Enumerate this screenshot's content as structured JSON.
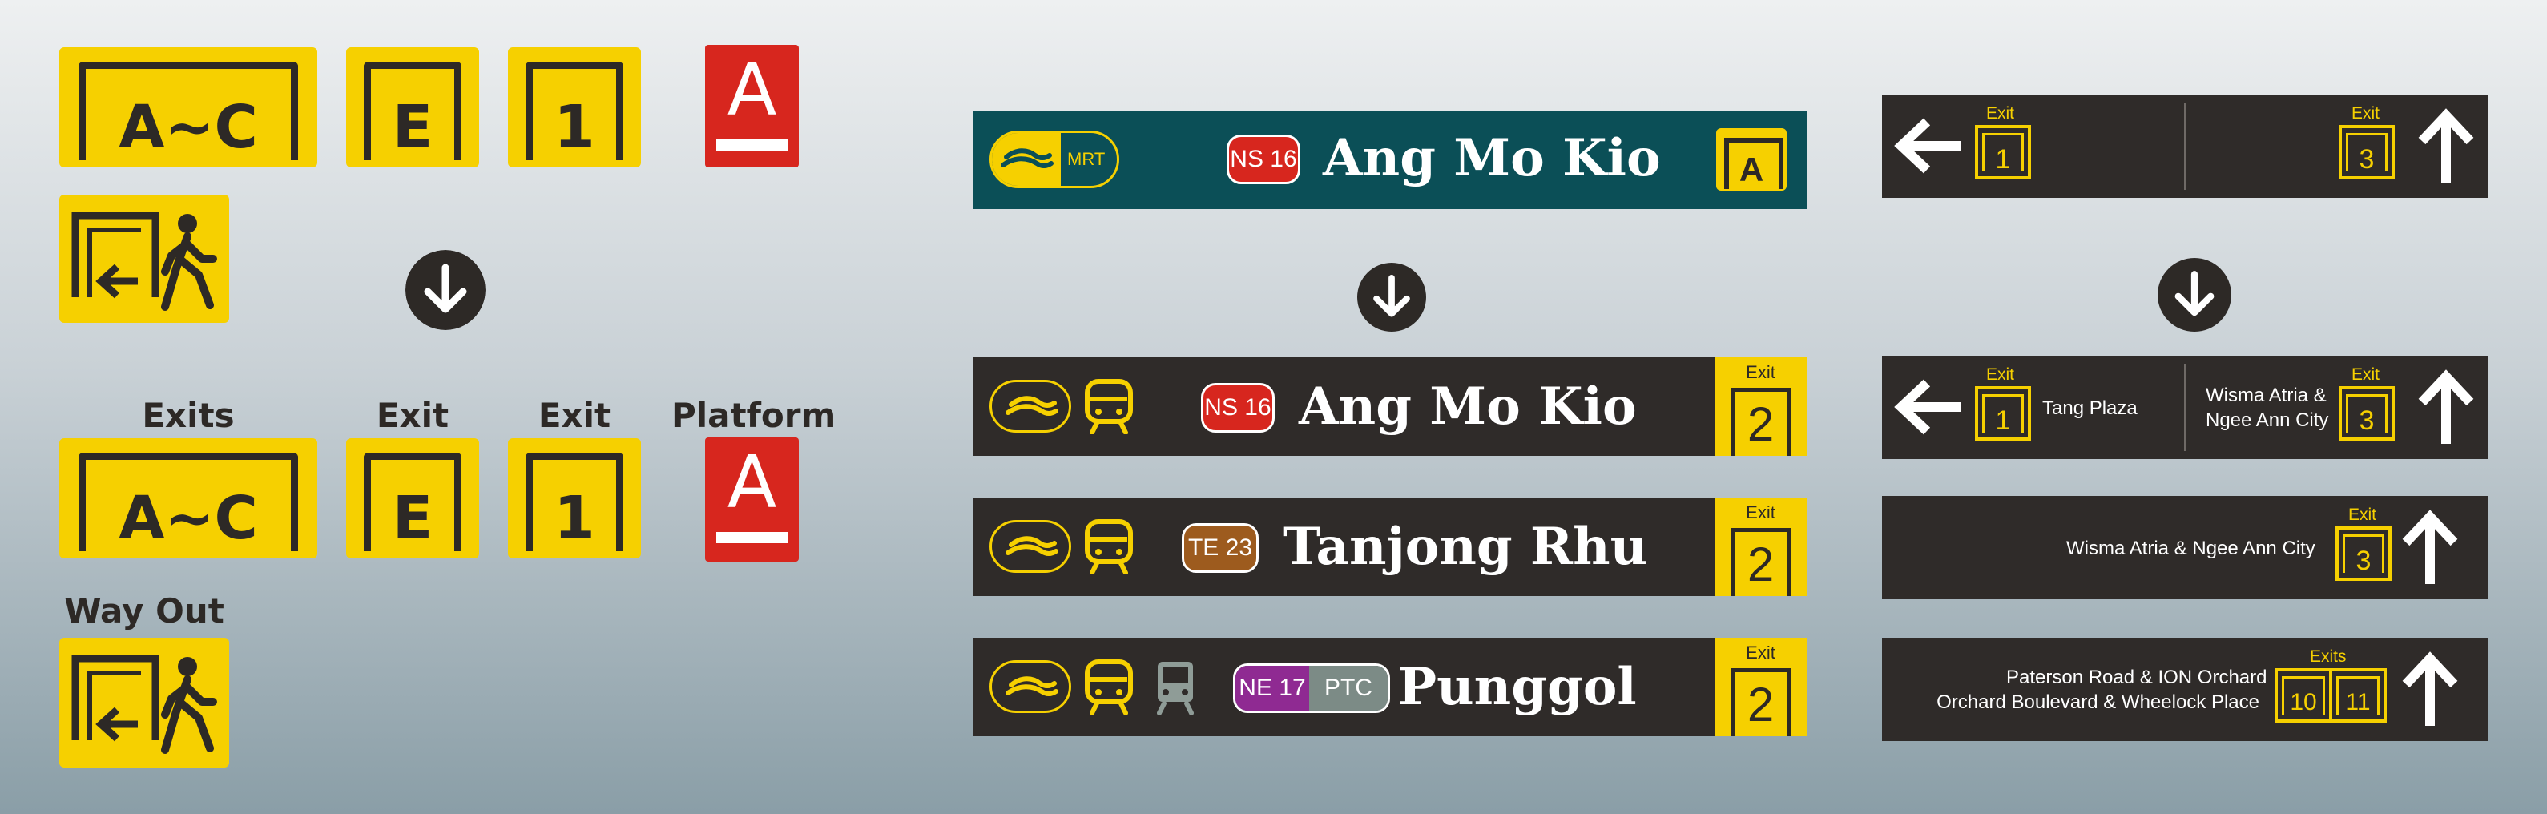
{
  "left": {
    "tiles_before": [
      "A~C",
      "E",
      "1"
    ],
    "platform_before": "A",
    "labels": {
      "exits": "Exits",
      "exit_e": "Exit",
      "exit_1": "Exit",
      "platform": "Platform",
      "way_out": "Way Out"
    },
    "tiles_after": [
      "A~C",
      "E",
      "1"
    ],
    "platform_after": "A"
  },
  "middle": {
    "top_bar": {
      "logo": "MRT",
      "code": "NS 16",
      "station": "Ang Mo Kio",
      "exit": "A"
    },
    "bars": [
      {
        "code": "NS 16",
        "station": "Ang Mo Kio",
        "exit_label": "Exit",
        "exit": "2",
        "code_color": "#d7261e"
      },
      {
        "code": "TE 23",
        "station": "Tanjong Rhu",
        "exit_label": "Exit",
        "exit": "2",
        "code_color": "#9d5b1e"
      },
      {
        "code": "NE 17",
        "code2": "PTC",
        "station": "Punggol",
        "exit_label": "Exit",
        "exit": "2",
        "code_color": "#8f2a92",
        "code2_color": "#7c8b86"
      }
    ]
  },
  "right": {
    "top_bar": {
      "left_label": "Exit",
      "left_exit": "1",
      "right_label": "Exit",
      "right_exit": "3"
    },
    "bar1": {
      "left_label": "Exit",
      "left_exit": "1",
      "left_dest": "Tang Plaza",
      "right_label": "Exit",
      "right_exit": "3",
      "right_dest_1": "Wisma Atria &",
      "right_dest_2": "Ngee Ann City"
    },
    "bar2": {
      "label": "Exit",
      "exit": "3",
      "dest": "Wisma Atria & Ngee Ann City"
    },
    "bar3": {
      "label": "Exits",
      "exit_a": "10",
      "exit_b": "11",
      "dest_1": "Paterson Road & ION Orchard",
      "dest_2": "Orchard Boulevard & Wheelock Place"
    }
  },
  "colors": {
    "exit_yellow": "#f6d000",
    "platform_red": "#d7261e",
    "sign_dark": "#2f2b29",
    "sign_teal": "#0b4f57"
  }
}
